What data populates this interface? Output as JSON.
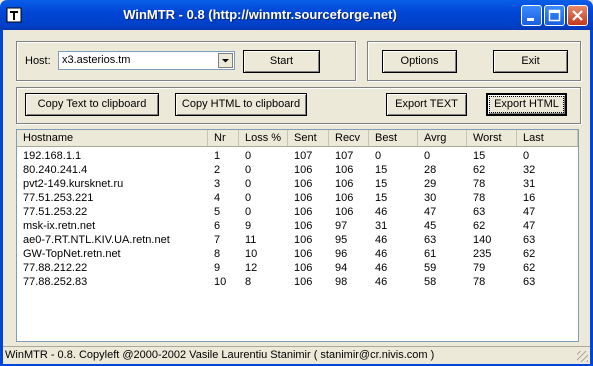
{
  "window": {
    "title": "WinMTR - 0.8 (http://winmtr.sourceforge.net)"
  },
  "host": {
    "label": "Host:",
    "value": "x3.asterios.tm"
  },
  "buttons": {
    "start": "Start",
    "options": "Options",
    "exit": "Exit",
    "copy_text": "Copy Text to clipboard",
    "copy_html": "Copy HTML to clipboard",
    "export_text": "Export TEXT",
    "export_html": "Export HTML"
  },
  "table": {
    "columns": [
      "Hostname",
      "Nr",
      "Loss %",
      "Sent",
      "Recv",
      "Best",
      "Avrg",
      "Worst",
      "Last"
    ],
    "rows": [
      [
        "192.168.1.1",
        "1",
        "0",
        "107",
        "107",
        "0",
        "0",
        "15",
        "0"
      ],
      [
        "80.240.241.4",
        "2",
        "0",
        "106",
        "106",
        "15",
        "28",
        "62",
        "32"
      ],
      [
        "pvt2-149.kursknet.ru",
        "3",
        "0",
        "106",
        "106",
        "15",
        "29",
        "78",
        "31"
      ],
      [
        "77.51.253.221",
        "4",
        "0",
        "106",
        "106",
        "15",
        "30",
        "78",
        "16"
      ],
      [
        "77.51.253.22",
        "5",
        "0",
        "106",
        "106",
        "46",
        "47",
        "63",
        "47"
      ],
      [
        "msk-ix.retn.net",
        "6",
        "9",
        "106",
        "97",
        "31",
        "45",
        "62",
        "47"
      ],
      [
        "ae0-7.RT.NTL.KIV.UA.retn.net",
        "7",
        "11",
        "106",
        "95",
        "46",
        "63",
        "140",
        "63"
      ],
      [
        "GW-TopNet.retn.net",
        "8",
        "10",
        "106",
        "96",
        "46",
        "61",
        "235",
        "62"
      ],
      [
        "77.88.212.22",
        "9",
        "12",
        "106",
        "94",
        "46",
        "59",
        "79",
        "62"
      ],
      [
        "77.88.252.83",
        "10",
        "8",
        "106",
        "98",
        "46",
        "58",
        "78",
        "63"
      ]
    ]
  },
  "status": {
    "text": "WinMTR - 0.8. Copyleft @2000-2002 Vasile Laurentiu Stanimir  ( stanimir@cr.nivis.com )"
  },
  "colors": {
    "titlebar": "#0046d6",
    "face": "#ece9d8"
  }
}
